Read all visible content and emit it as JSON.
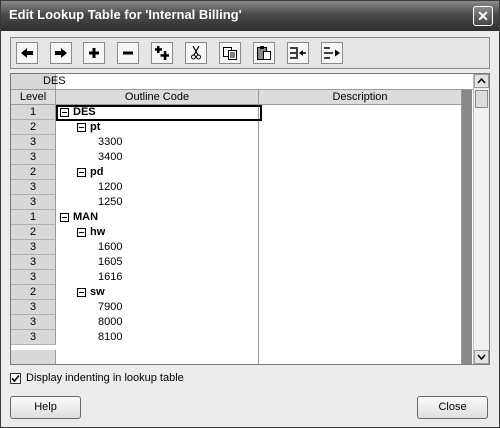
{
  "window": {
    "title": "Edit Lookup Table for 'Internal Billing'",
    "close_glyph": "✕"
  },
  "toolbar": {
    "buttons": [
      {
        "name": "move-left-icon"
      },
      {
        "name": "move-right-icon"
      },
      {
        "name": "plus-icon"
      },
      {
        "name": "minus-icon"
      },
      {
        "name": "insert-row-icon"
      },
      {
        "name": "cut-icon"
      },
      {
        "name": "copy-icon"
      },
      {
        "name": "paste-icon"
      },
      {
        "name": "insert-left-icon"
      },
      {
        "name": "insert-right-icon"
      }
    ]
  },
  "grid": {
    "edit_value": "DES",
    "columns": {
      "level": "Level",
      "outline_code": "Outline Code",
      "description": "Description"
    },
    "rows": [
      {
        "level": "1",
        "code": "DES",
        "depth": 0,
        "expandable": true
      },
      {
        "level": "2",
        "code": "pt",
        "depth": 1,
        "expandable": true
      },
      {
        "level": "3",
        "code": "3300",
        "depth": 2,
        "expandable": false
      },
      {
        "level": "3",
        "code": "3400",
        "depth": 2,
        "expandable": false
      },
      {
        "level": "2",
        "code": "pd",
        "depth": 1,
        "expandable": true
      },
      {
        "level": "3",
        "code": "1200",
        "depth": 2,
        "expandable": false
      },
      {
        "level": "3",
        "code": "1250",
        "depth": 2,
        "expandable": false
      },
      {
        "level": "1",
        "code": "MAN",
        "depth": 0,
        "expandable": true
      },
      {
        "level": "2",
        "code": "hw",
        "depth": 1,
        "expandable": true
      },
      {
        "level": "3",
        "code": "1600",
        "depth": 2,
        "expandable": false
      },
      {
        "level": "3",
        "code": "1605",
        "depth": 2,
        "expandable": false
      },
      {
        "level": "3",
        "code": "1616",
        "depth": 2,
        "expandable": false
      },
      {
        "level": "2",
        "code": "sw",
        "depth": 1,
        "expandable": true
      },
      {
        "level": "3",
        "code": "7900",
        "depth": 2,
        "expandable": false
      },
      {
        "level": "3",
        "code": "8000",
        "depth": 2,
        "expandable": false
      },
      {
        "level": "3",
        "code": "8100",
        "depth": 2,
        "expandable": false
      }
    ]
  },
  "options": {
    "display_indenting_label": "Display indenting in lookup table",
    "display_indenting_checked": true
  },
  "buttons": {
    "help_label": "Help",
    "close_label": "Close"
  }
}
